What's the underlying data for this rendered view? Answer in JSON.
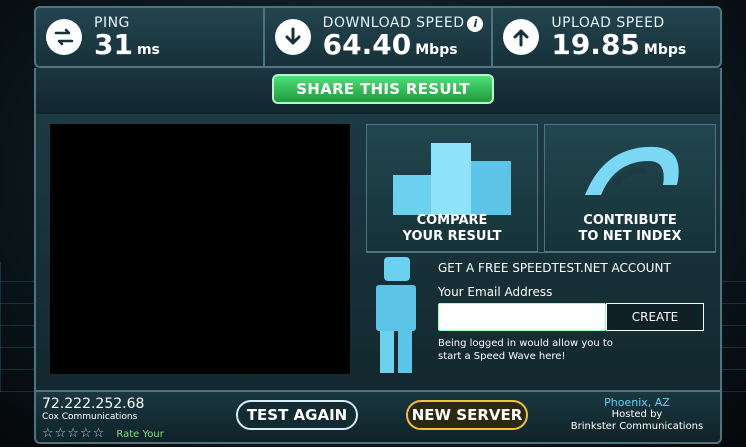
{
  "stats": {
    "ping": {
      "title": "PING",
      "value": "31",
      "unit": "ms",
      "icon": "ping-arrows-icon"
    },
    "download": {
      "title": "DOWNLOAD SPEED",
      "value": "64.40",
      "unit": "Mbps",
      "icon": "download-arrow-icon"
    },
    "upload": {
      "title": "UPLOAD SPEED",
      "value": "19.85",
      "unit": "Mbps",
      "icon": "upload-arrow-icon"
    }
  },
  "share_button": "SHARE THIS RESULT",
  "tiles": {
    "compare": "COMPARE\nYOUR RESULT",
    "contribute": "CONTRIBUTE\nTO NET INDEX"
  },
  "signup": {
    "title": "GET A FREE SPEEDTEST.NET ACCOUNT",
    "email_label": "Your Email Address",
    "email_value": "",
    "create_button": "CREATE",
    "note": "Being logged in would allow you to start a Speed Wave here!"
  },
  "isp": {
    "ip": "72.222.252.68",
    "name": "Cox Communications",
    "stars": "☆☆☆☆☆",
    "rate_label": "Rate Your"
  },
  "buttons": {
    "test_again": "TEST AGAIN",
    "new_server": "NEW SERVER"
  },
  "server": {
    "city": "Phoenix, AZ",
    "hosted_by": "Hosted by",
    "host": "Brinkster Communications"
  },
  "colors": {
    "accent_green": "#2fbf55",
    "accent_gold": "#f0c040",
    "panel": "#1c3a44",
    "border": "#4e7480"
  }
}
